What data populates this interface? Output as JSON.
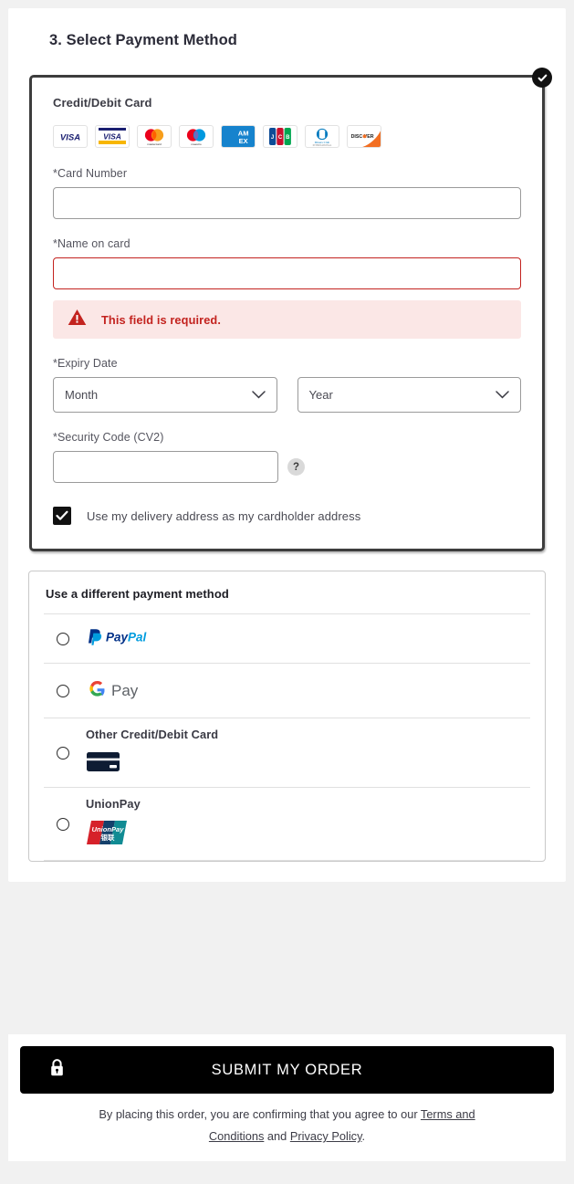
{
  "section": {
    "title": "3. Select Payment Method"
  },
  "selected_method": {
    "heading": "Credit/Debit Card",
    "selected_badge_icon": "check-circle-icon",
    "accepted_cards": [
      {
        "name": "visa",
        "label": "VISA"
      },
      {
        "name": "visa-electron",
        "label": "VISA"
      },
      {
        "name": "mastercard",
        "label": "mastercard"
      },
      {
        "name": "maestro",
        "label": "maestro"
      },
      {
        "name": "american-express",
        "label": "AMEX"
      },
      {
        "name": "jcb",
        "label": "JCB"
      },
      {
        "name": "diners-club",
        "label": "Diners Club International"
      },
      {
        "name": "discover",
        "label": "DISCOVER"
      }
    ],
    "card_number": {
      "label": "*Card Number",
      "value": "",
      "placeholder": ""
    },
    "name_on_card": {
      "label": "*Name on card",
      "value": "",
      "placeholder": "",
      "error": "This field is required.",
      "error_icon": "warning-triangle-icon"
    },
    "expiry": {
      "label": "*Expiry Date",
      "month": {
        "value": "Month"
      },
      "year": {
        "value": "Year"
      }
    },
    "security_code": {
      "label": "*Security Code (CV2)",
      "value": "",
      "placeholder": "",
      "help_icon": "question-mark-icon",
      "help_label": "?"
    },
    "billing_checkbox": {
      "label": "Use my delivery address as my cardholder address",
      "checked": true
    }
  },
  "alternate_methods": {
    "heading": "Use a different payment method",
    "options": [
      {
        "id": "paypal",
        "title": "",
        "logo": "paypal-logo",
        "selected": false
      },
      {
        "id": "google-pay",
        "title": "",
        "logo": "google-pay-logo",
        "selected": false
      },
      {
        "id": "other-card",
        "title": "Other Credit/Debit Card",
        "logo": "credit-card-icon",
        "selected": false
      },
      {
        "id": "unionpay",
        "title": "UnionPay",
        "logo": "unionpay-logo",
        "selected": false
      }
    ]
  },
  "submit": {
    "label": "SUBMIT MY ORDER",
    "lock_icon": "lock-icon"
  },
  "legal": {
    "text_before": "By placing this order, you are confirming that you agree to our ",
    "terms_link": "Terms and Conditions",
    "text_middle": " and ",
    "privacy_link": "Privacy Policy",
    "text_after": "."
  },
  "colors": {
    "page_background": "#f1f1f1",
    "card_background": "#ffffff",
    "error_red": "#c3231f",
    "error_background": "#fbe7e6",
    "submit_background": "#000000",
    "selected_border": "#3d3d3d"
  }
}
